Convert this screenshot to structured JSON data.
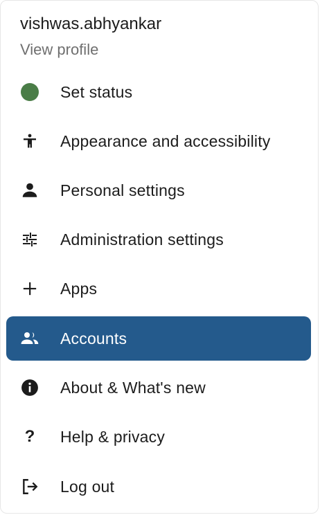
{
  "user": {
    "name": "vishwas.abhyankar",
    "view_profile": "View profile"
  },
  "menu": {
    "items": [
      {
        "label": "Set status",
        "icon": "status-dot-icon",
        "icon_color": "#4a7d47"
      },
      {
        "label": "Appearance and accessibility",
        "icon": "accessibility-icon"
      },
      {
        "label": "Personal settings",
        "icon": "person-icon"
      },
      {
        "label": "Administration settings",
        "icon": "sliders-icon"
      },
      {
        "label": "Apps",
        "icon": "plus-icon"
      },
      {
        "label": "Accounts",
        "icon": "people-icon",
        "selected": true
      },
      {
        "label": "About & What's new",
        "icon": "info-icon"
      },
      {
        "label": "Help & privacy",
        "icon": "question-icon"
      },
      {
        "label": "Log out",
        "icon": "logout-icon"
      }
    ]
  },
  "colors": {
    "selected_bg": "#245a8c",
    "text": "#1c1c1c",
    "muted_text": "#6f6f6f"
  }
}
